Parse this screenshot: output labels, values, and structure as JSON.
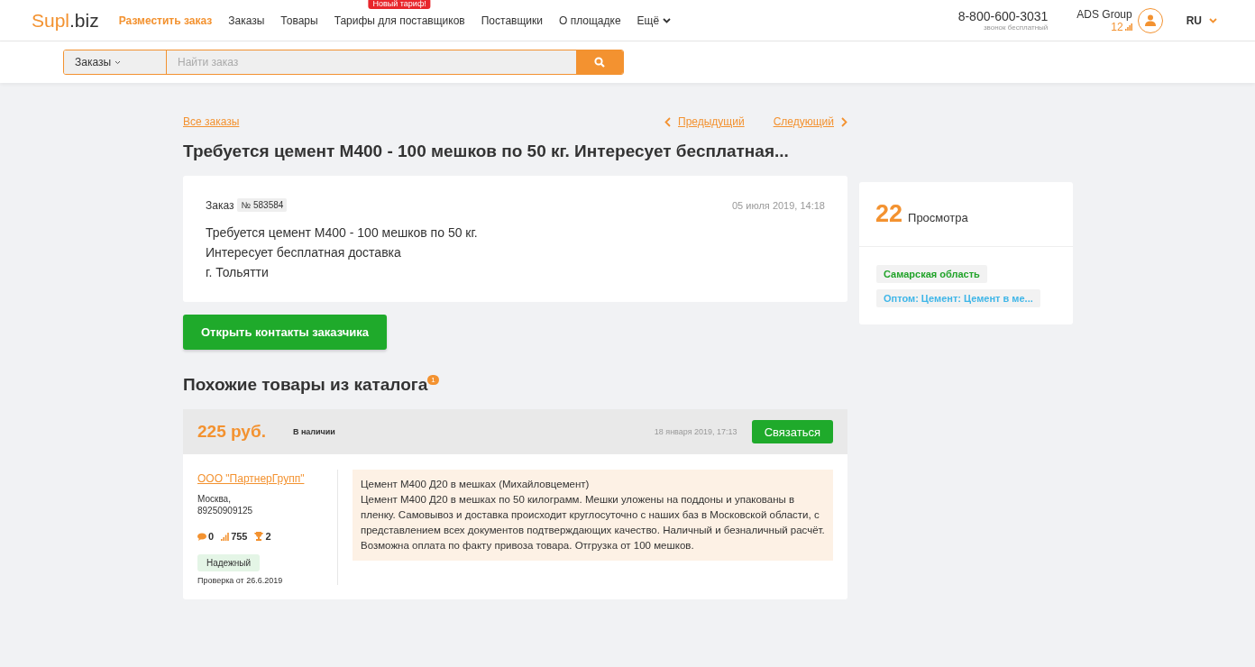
{
  "header": {
    "logo_accent": "Supl",
    "logo_rest": ".biz",
    "nav": [
      {
        "label": "Разместить заказ",
        "selected": true
      },
      {
        "label": "Заказы",
        "selected": false
      },
      {
        "label": "Товары",
        "selected": false
      },
      {
        "label": "Тарифы для поставщиков",
        "selected": false,
        "badge": "Новый тариф!"
      },
      {
        "label": "Поставщики",
        "selected": false
      },
      {
        "label": "О площадке",
        "selected": false
      },
      {
        "label": "Ещё",
        "selected": false,
        "dropdown": true
      }
    ],
    "phone": "8-800-600-3031",
    "phone_note": "звонок бесплатный",
    "user": "ADS Group",
    "user_rating": "12",
    "language": "RU"
  },
  "search": {
    "scope": "Заказы",
    "placeholder": "Найти заказ"
  },
  "breadcrumbs": {
    "all": "Все заказы",
    "prev": "Предыдущий",
    "next": "Следующий"
  },
  "title": "Требуется цемент М400 - 100 мешков по 50 кг. Интересует бесплатная...",
  "order": {
    "label": "Заказ",
    "number": "№ 583584",
    "date": "05 июля 2019, 14:18",
    "lines": [
      "Требуется цемент М400 - 100 мешков по 50 кг.",
      "Интересует бесплатная доставка",
      "г. Тольятти"
    ]
  },
  "open_contacts": "Открыть контакты заказчика",
  "side": {
    "views_count": "22",
    "views_label": "Просмотра",
    "tags": [
      {
        "label": "Самарская область",
        "color": "#22a32a"
      },
      {
        "label": "Оптом: Цемент: Цемент в ме...",
        "color": "#3fb6e8"
      }
    ]
  },
  "similar": {
    "title": "Похожие товары из каталога",
    "count": "1",
    "items": [
      {
        "price": "225 руб.",
        "availability": "В наличии",
        "date": "18 января 2019, 17:13",
        "contact": "Связаться",
        "company": "ООО \"ПартнерГрупп\"",
        "city": "Москва,",
        "phone": "89250909125",
        "comments": "0",
        "rating": "755",
        "awards": "2",
        "trust": "Надежный",
        "check": "Проверка от 26.6.2019",
        "product_title": "Цемент М400 Д20 в мешках (Михайловцемент)",
        "description": "Цемент М400 Д20 в мешках по 50 килограмм. Мешки уложены на поддоны и упакованы в пленку. Самовывоз и доставка происходит круглосуточно с наших баз в Московской области, с представлением всех документов подтверждающих качество. Наличный и безналичный расчёт. Возможна оплата по факту привоза товара. Отгрузка от 100 мешков."
      }
    ]
  }
}
